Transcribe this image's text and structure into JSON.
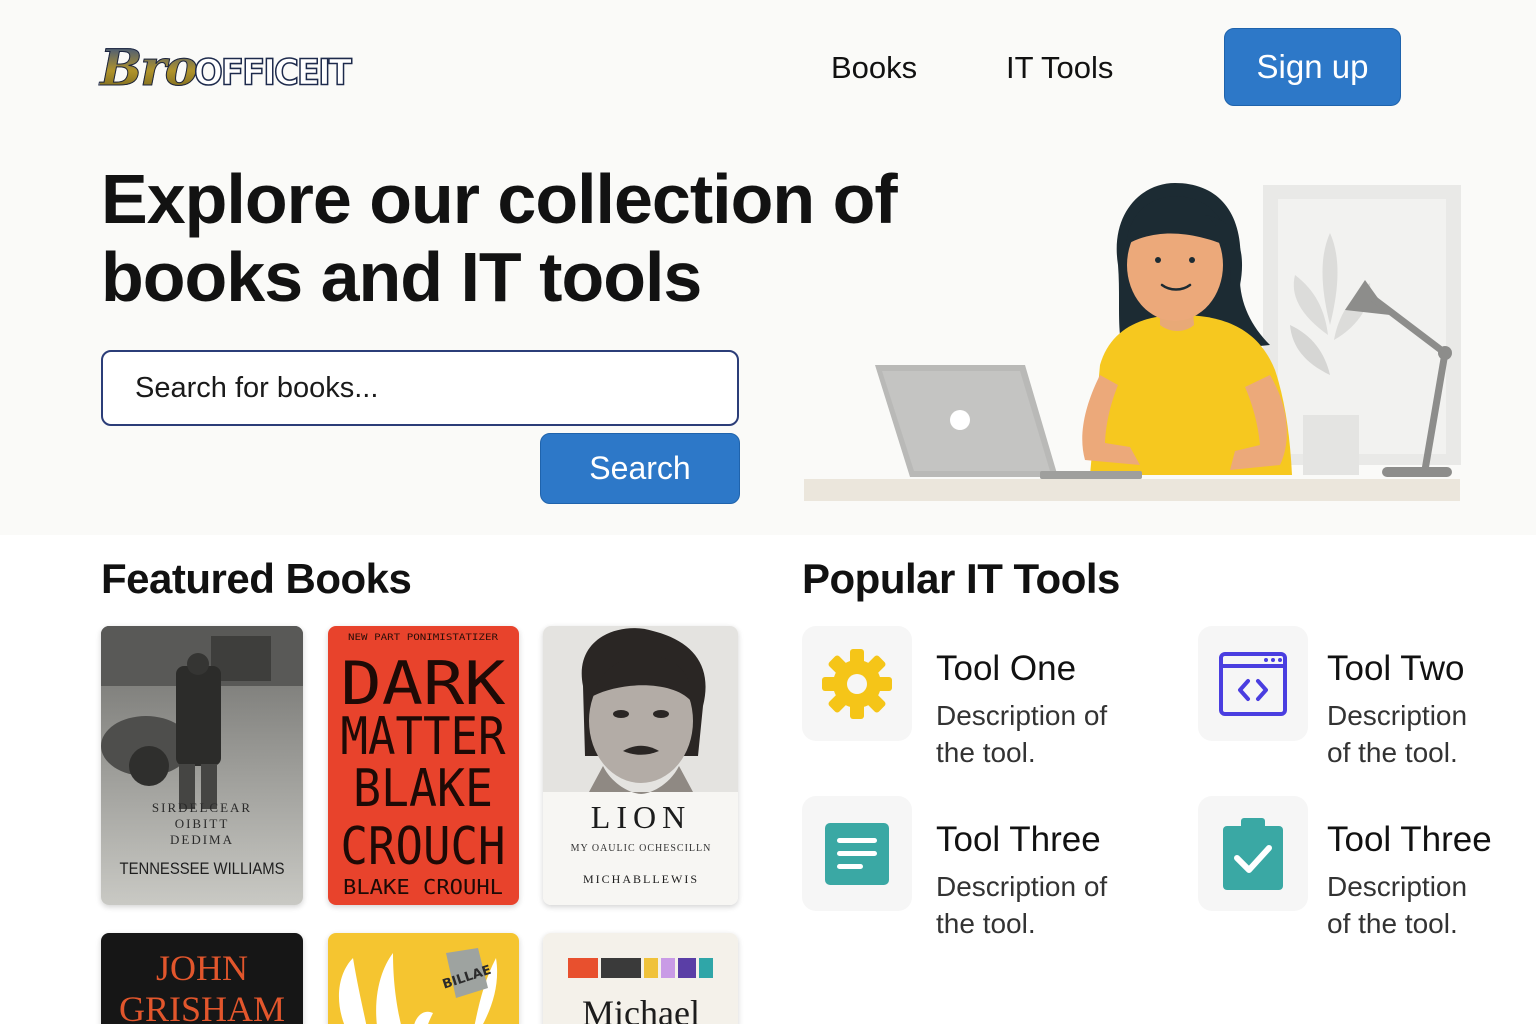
{
  "header": {
    "logo_part1": "Bro",
    "logo_part2": "OFFICEIT",
    "nav": [
      {
        "label": "Books"
      },
      {
        "label": "IT Tools"
      }
    ],
    "signup_label": "Sign up"
  },
  "hero": {
    "title_line1": "Explore our collection of",
    "title_line2": "books and IT tools",
    "search_placeholder": "Search for books...",
    "search_button": "Search"
  },
  "featured_books": {
    "title": "Featured Books",
    "books": [
      {
        "cover_text": [
          "SIRDELCEAR",
          "OIBITT",
          "DEDIMA"
        ],
        "author": "TENNESSEE WILLIAMS",
        "style": "photo-grey"
      },
      {
        "tagline": "NEW PART PONIMISTATIZER",
        "title_lines": [
          "DARK",
          "MATTER",
          "BLAKE",
          "CROUCH"
        ],
        "author": "BLAKE CROUHL",
        "color": "#e8432c"
      },
      {
        "title": "LION",
        "subtitle": "MY OAULIC OCHESCILLN",
        "author": "MICHABLLEWIS",
        "style": "portrait"
      },
      {
        "title_lines": [
          "JOHN",
          "GRISHAM"
        ],
        "color": "#161616"
      },
      {
        "badge": "BILLAE",
        "color": "#f5c530"
      },
      {
        "title": "Michael",
        "color": "#f4f1ea"
      }
    ]
  },
  "tools": {
    "title": "Popular IT Tools",
    "items": [
      {
        "name": "Tool One",
        "desc_line1": "Description of",
        "desc_line2": "the tool.",
        "icon": "gear-icon",
        "icon_color": "#f5c518"
      },
      {
        "name": "Tool Two",
        "desc_line1": "Description",
        "desc_line2": "of the tool.",
        "icon": "code-window-icon",
        "icon_color": "#4a3ee0"
      },
      {
        "name": "Tool Three",
        "desc_line1": "Description of",
        "desc_line2": "the tool.",
        "icon": "document-icon",
        "icon_color": "#3aa8a4"
      },
      {
        "name": "Tool Three",
        "desc_line1": "Description",
        "desc_line2": "of the tool.",
        "icon": "clipboard-check-icon",
        "icon_color": "#3aa8a4"
      }
    ]
  },
  "colors": {
    "primary": "#2d78c8",
    "accent_yellow": "#f5c518",
    "accent_teal": "#3aa8a4",
    "accent_indigo": "#4a3ee0"
  }
}
